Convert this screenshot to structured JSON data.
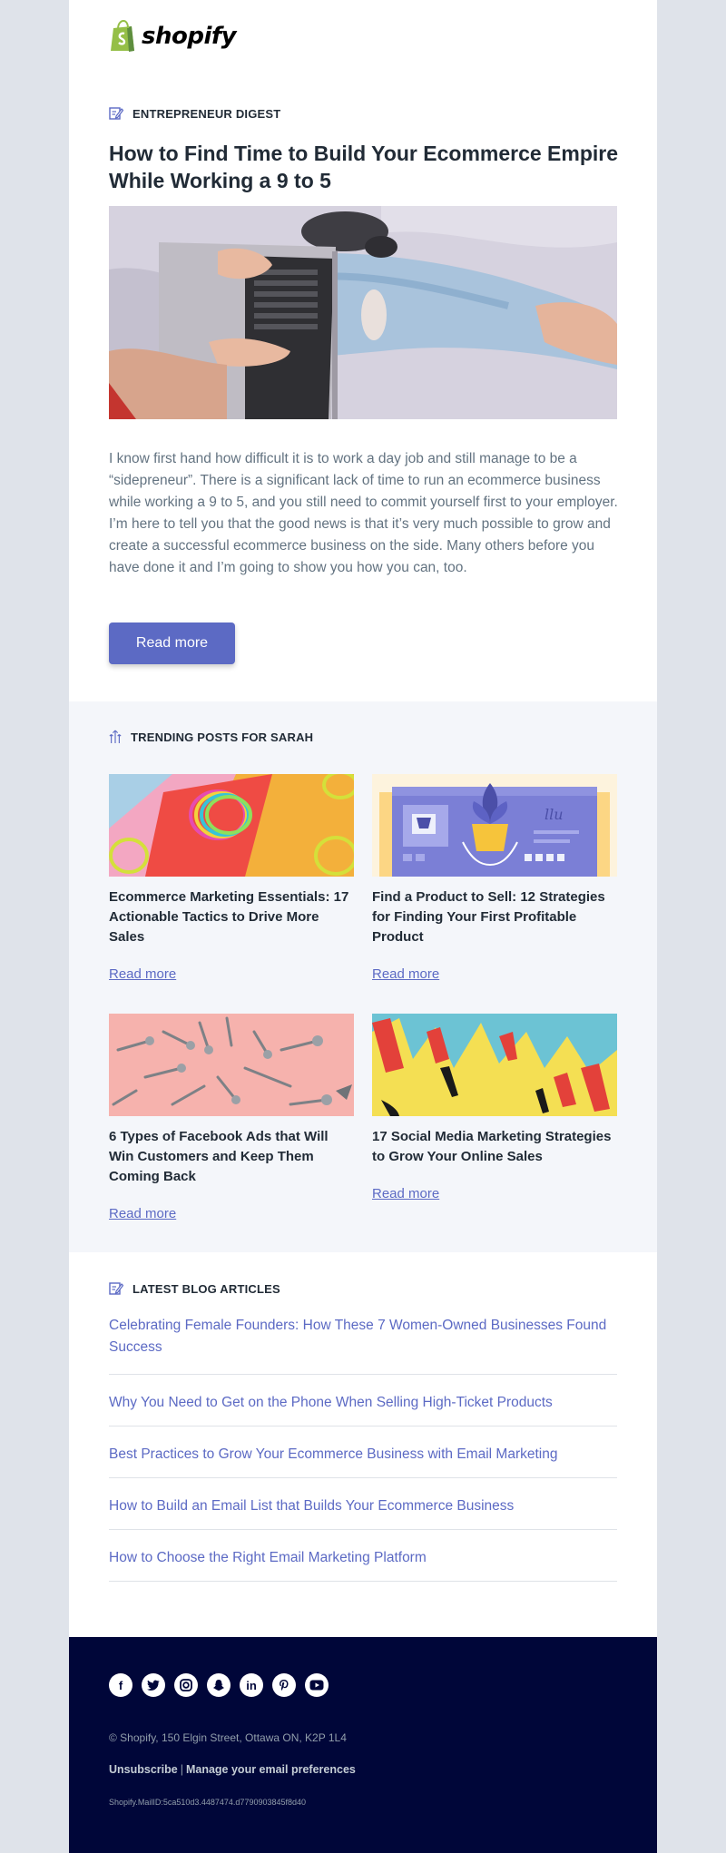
{
  "brand": {
    "name": "shopify",
    "accent": "#5c6ac4",
    "logo_green": "#95bf47"
  },
  "digest": {
    "section_label": "ENTREPRENEUR DIGEST",
    "title": "How to Find Time to Build Your Ecommerce Empire While Working a 9 to 5",
    "body": "I know first hand how difficult it is to work a day job and still manage to be a “sidepreneur”. There is a significant lack of time to run an ecommerce business while working a 9 to 5, and you still need to commit yourself first to your employer. I’m here to tell you that the good news is that it’s very much possible to grow and create a successful ecommerce business on the side. Many others before you have done it and I’m going to show you how you can, too.",
    "button": "Read more"
  },
  "trending": {
    "section_label": "TRENDING POSTS FOR SARAH",
    "posts": [
      {
        "title": "Ecommerce Marketing Essentials: 17 Actionable Tactics to Drive More Sales",
        "link": "Read more"
      },
      {
        "title": "Find a Product to Sell: 12 Strategies for Finding Your First Profitable Product",
        "link": "Read more"
      },
      {
        "title": "6 Types of Facebook Ads that Will Win Customers and Keep Them Coming Back",
        "link": "Read more"
      },
      {
        "title": "17 Social Media Marketing Strategies to Grow Your Online Sales",
        "link": "Read more"
      }
    ]
  },
  "latest": {
    "section_label": "LATEST BLOG ARTICLES",
    "articles": [
      "Celebrating Female Founders: How These 7 Women-Owned Businesses Found Success",
      "Why You Need to Get on the Phone When Selling High-Ticket Products",
      "Best Practices to Grow Your Ecommerce Business with Email Marketing",
      "How to Build an Email List that Builds Your Ecommerce Business",
      "How to Choose the Right Email Marketing Platform"
    ]
  },
  "footer": {
    "socials": [
      "facebook-icon",
      "twitter-icon",
      "instagram-icon",
      "snapchat-icon",
      "linkedin-icon",
      "pinterest-icon",
      "youtube-icon"
    ],
    "address": "© Shopify,  150 Elgin Street, Ottawa ON, K2P 1L4",
    "unsubscribe": "Unsubscribe",
    "separator": "|",
    "preferences": "Manage your email preferences",
    "mail_id": "Shopify.MailID:5ca510d3.4487474.d7790903845f8d40"
  }
}
